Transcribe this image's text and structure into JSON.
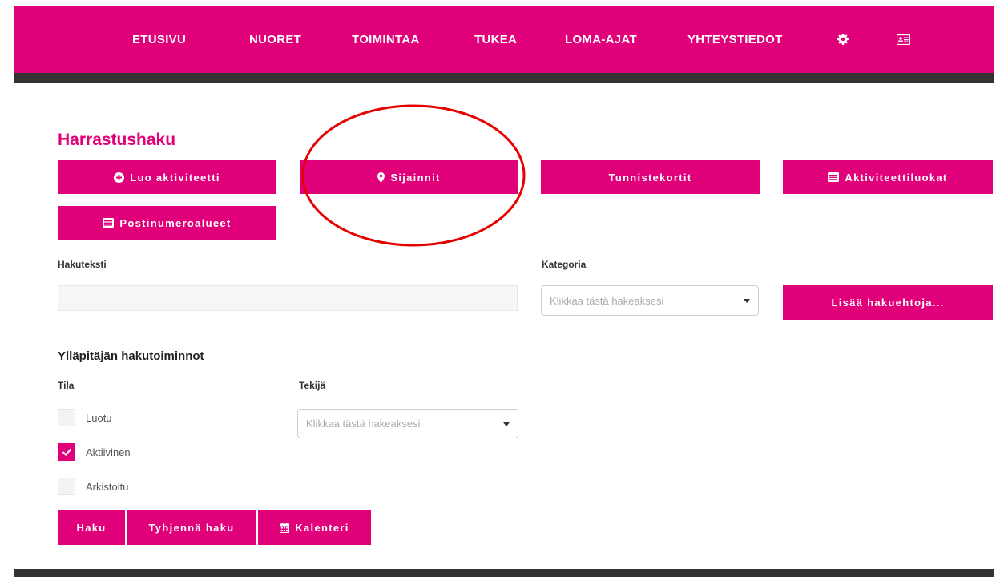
{
  "nav": {
    "items": [
      "ETUSIVU",
      "NUORET",
      "TOIMINTAA",
      "TUKEA",
      "LOMA-AJAT",
      "YHTEYSTIEDOT"
    ],
    "icons": [
      "gear-icon",
      "id-card-icon"
    ]
  },
  "page": {
    "title": "Harrastushaku"
  },
  "buttons": {
    "create_activity": "Luo aktiviteetti",
    "locations": "Sijainnit",
    "id_cards": "Tunnistekortit",
    "activity_categories": "Aktiviteettiluokat",
    "postal_areas": "Postinumeroalueet",
    "more_criteria": "Lisää hakuehtoja...",
    "search": "Haku",
    "clear_search": "Tyhjennä haku",
    "calendar": "Kalenteri"
  },
  "search": {
    "text_label": "Hakuteksti",
    "text_value": "",
    "category_label": "Kategoria",
    "category_placeholder": "Klikkaa tästä hakeaksesi"
  },
  "admin": {
    "title": "Ylläpitäjän hakutoiminnot",
    "state_label": "Tila",
    "author_label": "Tekijä",
    "author_placeholder": "Klikkaa tästä hakeaksesi",
    "states": [
      {
        "label": "Luotu",
        "checked": false
      },
      {
        "label": "Aktiivinen",
        "checked": true
      },
      {
        "label": "Arkistoitu",
        "checked": false
      }
    ]
  },
  "colors": {
    "brand": "#e0007a",
    "dark": "#333333",
    "annotation": "#e60000"
  }
}
